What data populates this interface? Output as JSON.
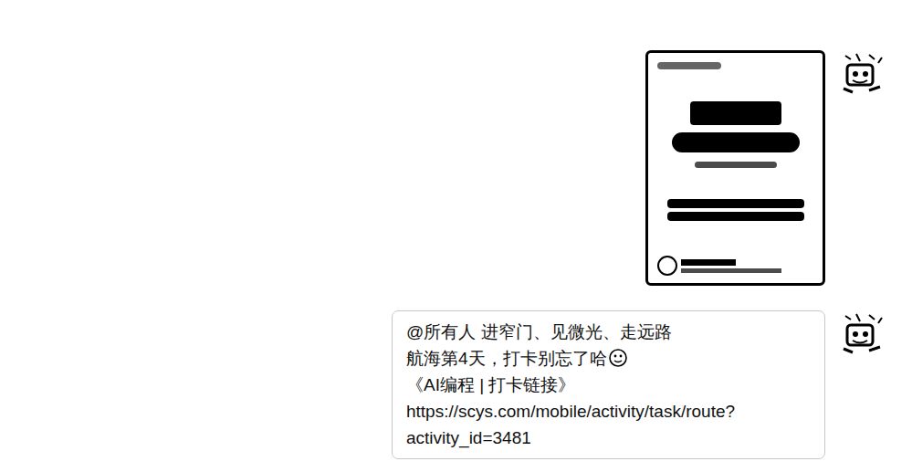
{
  "messages": [
    {
      "kind": "image"
    },
    {
      "kind": "text",
      "lines": [
        "@所有人 进窄门、见微光、走远路",
        "航海第4天，打卡别忘了哈",
        "《AI编程 | 打卡链接》",
        "https://scys.com/mobile/activity/task/route?",
        "activity_id=3481"
      ]
    }
  ]
}
